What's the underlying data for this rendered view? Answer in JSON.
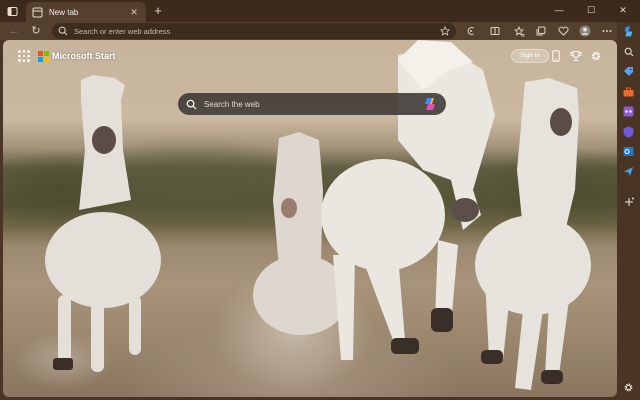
{
  "tab": {
    "title": "New tab",
    "close_glyph": "✕"
  },
  "tabstrip": {
    "new_tab_glyph": "+"
  },
  "window_controls": {
    "minimize": "—",
    "maximize": "☐",
    "close": "✕"
  },
  "toolbar": {
    "back_glyph": "←",
    "refresh_glyph": "↻",
    "address_placeholder": "Search or enter web address"
  },
  "page": {
    "brand": "Microsoft Start",
    "sign_in_label": "Sign in",
    "search_placeholder": "Search the web"
  },
  "colors": {
    "frame": "#4a3524",
    "tab_strip": "#3d2a1c",
    "active_tab": "#55402e",
    "ms_red": "#f25022",
    "ms_green": "#7fba00",
    "ms_blue": "#00a4ef",
    "ms_yellow": "#ffb900"
  },
  "icons": {
    "tab_actions": "tab-actions-icon",
    "favicon": "new-tab-favicon-icon",
    "search": "search-icon",
    "favorites_star": "star-icon",
    "copilot": "copilot-icon",
    "settings": "gear-icon"
  }
}
